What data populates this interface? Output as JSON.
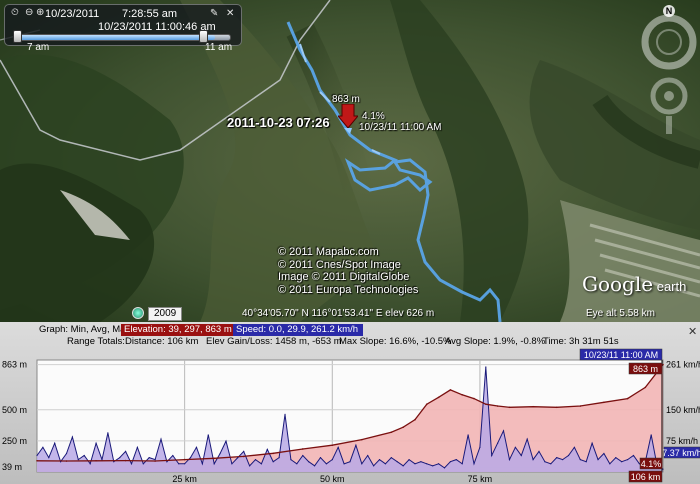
{
  "time_slider": {
    "start_date": "10/23/2011",
    "start_time": "7:28:55 am",
    "current": "10/23/2011  11:00:46 am",
    "range_start": "7 am",
    "range_end": "11 am",
    "position": 0.93
  },
  "compass": {
    "north": "N"
  },
  "marker": {
    "elevation": "863 m",
    "grade": "4.1%",
    "datetime": "10/23/11 11:00 AM",
    "timestamp": "2011-10-23 07:26"
  },
  "copyright": [
    "© 2011 Mapabc.com",
    "© 2011 Cnes/Spot Image",
    "Image © 2011 DigitalGlobe",
    "© 2011 Europa Technologies"
  ],
  "logo": {
    "main": "Google",
    "sub": "earth"
  },
  "status_bar": {
    "year": "2009",
    "coordinates": "40°34'05.70\" N 116°01'53.41\" E elev   626 m",
    "eye_alt": "Eye alt    5.58 km"
  },
  "profile": {
    "graph_label": "Graph: Min, Avg, Max",
    "elevation_stats": "Elevation: 39, 297, 863 m",
    "speed_stats": "Speed: 0.0, 29.9, 261.2 km/h",
    "range_totals_label": "Range Totals:",
    "distance": "Distance: 106 km",
    "elev_gain_loss": "Elev Gain/Loss: 1458 m, -653 m",
    "max_slope": "Max Slope: 16.6%, -10.5%",
    "avg_slope": "Avg Slope: 1.9%, -0.8%",
    "time": "Time: 3h 31m 51s",
    "close": "✕",
    "current_time_tag": "10/23/11 11:00 AM",
    "cursor_elev_tag": "863 m",
    "cursor_grade_tag": "4.1%",
    "cursor_dist_tag": "106 km",
    "cursor_speed_tag": "7.37 km/h",
    "colors": {
      "elevation_tag": "#9a1010",
      "speed_tag": "#2a2aa8",
      "elevation_line": "#7a1010",
      "elevation_fill": "#f2b5b5",
      "speed_line": "#1a1a7a",
      "speed_fill": "#b9a9e6"
    }
  },
  "chart_data": {
    "type": "line",
    "x_ticks": [
      "25 km",
      "50 km",
      "75 km"
    ],
    "x_tick_values": [
      25,
      50,
      75
    ],
    "xlim": [
      0,
      106
    ],
    "y_left_ticks": [
      "863 m",
      "500 m",
      "250 m",
      "39 m"
    ],
    "y_left_values": [
      863,
      500,
      250,
      39
    ],
    "ylim_left": [
      0,
      900
    ],
    "y_right_ticks": [
      "261 km/h",
      "150 km/h",
      "75 km/h"
    ],
    "y_right_values": [
      261,
      150,
      75
    ],
    "ylim_right": [
      0,
      272
    ],
    "series": [
      {
        "name": "Elevation",
        "axis": "left",
        "x": [
          0,
          5,
          10,
          15,
          20,
          25,
          30,
          35,
          40,
          45,
          50,
          55,
          60,
          62,
          64,
          66,
          68,
          70,
          72,
          74,
          76,
          78,
          80,
          84,
          88,
          92,
          96,
          100,
          103,
          106
        ],
        "y": [
          90,
          88,
          90,
          92,
          88,
          100,
          110,
          125,
          150,
          185,
          215,
          260,
          320,
          360,
          420,
          545,
          600,
          660,
          620,
          590,
          545,
          530,
          520,
          525,
          520,
          530,
          560,
          590,
          680,
          863
        ]
      },
      {
        "name": "Speed",
        "axis": "right",
        "x": [
          0,
          1,
          2,
          3,
          4,
          5,
          6,
          7,
          8,
          9,
          10,
          11,
          12,
          13,
          14,
          15,
          16,
          17,
          18,
          19,
          20,
          21,
          22,
          23,
          24,
          25,
          26,
          27,
          28,
          29,
          30,
          31,
          32,
          33,
          34,
          35,
          36,
          37,
          38,
          39,
          40,
          41,
          42,
          43,
          44,
          45,
          46,
          47,
          48,
          49,
          50,
          51,
          52,
          53,
          54,
          55,
          56,
          57,
          58,
          59,
          60,
          61,
          62,
          63,
          64,
          65,
          66,
          67,
          68,
          69,
          70,
          71,
          72,
          73,
          74,
          75,
          76,
          77,
          78,
          79,
          80,
          81,
          82,
          83,
          84,
          85,
          86,
          87,
          88,
          89,
          90,
          91,
          92,
          93,
          94,
          95,
          96,
          97,
          98,
          99,
          100,
          101,
          102,
          103,
          104,
          105,
          106
        ],
        "y": [
          40,
          60,
          35,
          70,
          25,
          45,
          85,
          30,
          40,
          20,
          70,
          30,
          95,
          25,
          35,
          50,
          20,
          60,
          20,
          35,
          30,
          80,
          25,
          40,
          20,
          20,
          35,
          60,
          20,
          90,
          20,
          45,
          75,
          20,
          35,
          50,
          15,
          30,
          20,
          55,
          25,
          35,
          140,
          30,
          20,
          40,
          25,
          15,
          35,
          20,
          30,
          60,
          20,
          25,
          65,
          20,
          40,
          15,
          30,
          20,
          35,
          25,
          15,
          30,
          20,
          25,
          20,
          15,
          20,
          10,
          25,
          30,
          20,
          90,
          20,
          60,
          255,
          40,
          70,
          100,
          30,
          60,
          40,
          80,
          30,
          50,
          25,
          20,
          35,
          30,
          40,
          60,
          30,
          25,
          70,
          30,
          45,
          20,
          35,
          25,
          30,
          40,
          20,
          25,
          90,
          15,
          7
        ]
      }
    ],
    "cursor_x": 106
  }
}
